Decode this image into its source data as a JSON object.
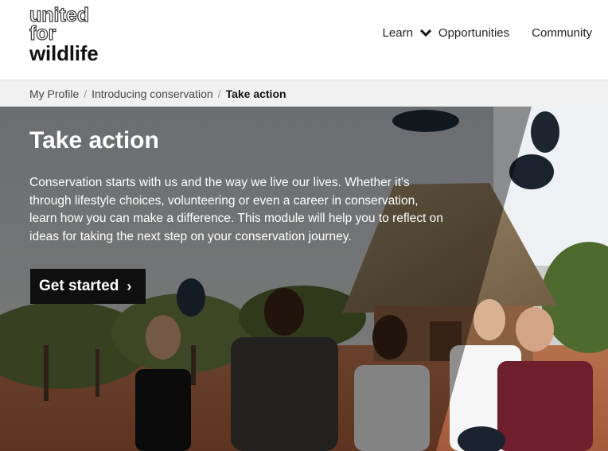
{
  "logo": {
    "line1": "united",
    "line2": "for",
    "line3": "wildlife"
  },
  "nav": {
    "learn": "Learn",
    "opportunities": "Opportunities",
    "community": "Community"
  },
  "breadcrumb": {
    "items": [
      "My Profile",
      "Introducing conservation"
    ],
    "current": "Take action",
    "separator": "/"
  },
  "hero": {
    "title": "Take action",
    "description": "Conservation starts with us and the way we live our lives. Whether it's through lifestyle choices, volunteering or even a career in conservation, learn how you can make a difference. This module will help you to reflect on ideas for taking the next step on your conservation journey.",
    "cta_label": "Get started",
    "cta_icon": "›"
  },
  "colors": {
    "cta_bg": "#0f0f0f",
    "crumb_bg": "#f1f1f1"
  }
}
